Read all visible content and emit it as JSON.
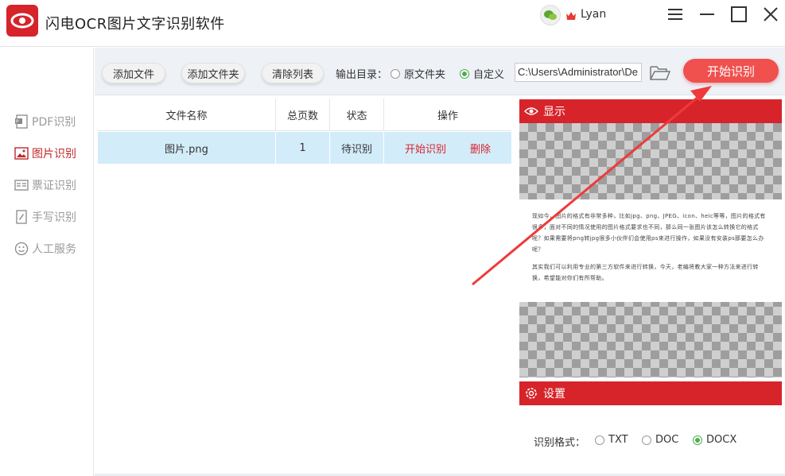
{
  "app": {
    "title": "闪电OCR图片文字识别软件",
    "user": "Lyan"
  },
  "sidebar": {
    "items": [
      {
        "label": "PDF识别"
      },
      {
        "label": "图片识别"
      },
      {
        "label": "票证识别"
      },
      {
        "label": "手写识别"
      },
      {
        "label": "人工服务"
      }
    ]
  },
  "toolbar": {
    "add_file": "添加文件",
    "add_folder": "添加文件夹",
    "clear_list": "清除列表",
    "output_label": "输出目录：",
    "option_original": "原文件夹",
    "option_custom": "自定义",
    "path_value": "C:\\Users\\Administrator\\De",
    "start": "开始识别"
  },
  "table": {
    "headers": [
      "文件名称",
      "总页数",
      "状态",
      "操作"
    ],
    "rows": [
      {
        "name": "图片.png",
        "pages": "1",
        "status": "待识别",
        "op_start": "开始识别",
        "op_delete": "删除"
      }
    ]
  },
  "preview": {
    "title": "显示",
    "text1": "现如今，图片的格式有非常多种，比如jpg、png、JPEG、icon、heic等等，图片的格式有很多，面对不同的情况使用的图片格式要求也不同，那么同一张图片该怎么转换它的格式呢？如果需要将png转jpg很多小伙伴们会使用ps来进行操作，如果没有安装ps那要怎么办呢？",
    "text2": "其实我们可以利用专业的第三方软件来进行转换，今天，老编将教大家一种方法来进行转换，希望能对你们有所帮助。"
  },
  "settings": {
    "title": "设置",
    "format_label": "识别格式：",
    "formats": [
      "TXT",
      "DOC",
      "DOCX"
    ],
    "selected": "DOCX"
  },
  "colors": {
    "accent": "#d7232a",
    "button": "#f0504e",
    "selected_row": "#d3ecfa",
    "radio_on": "#4caf50"
  }
}
